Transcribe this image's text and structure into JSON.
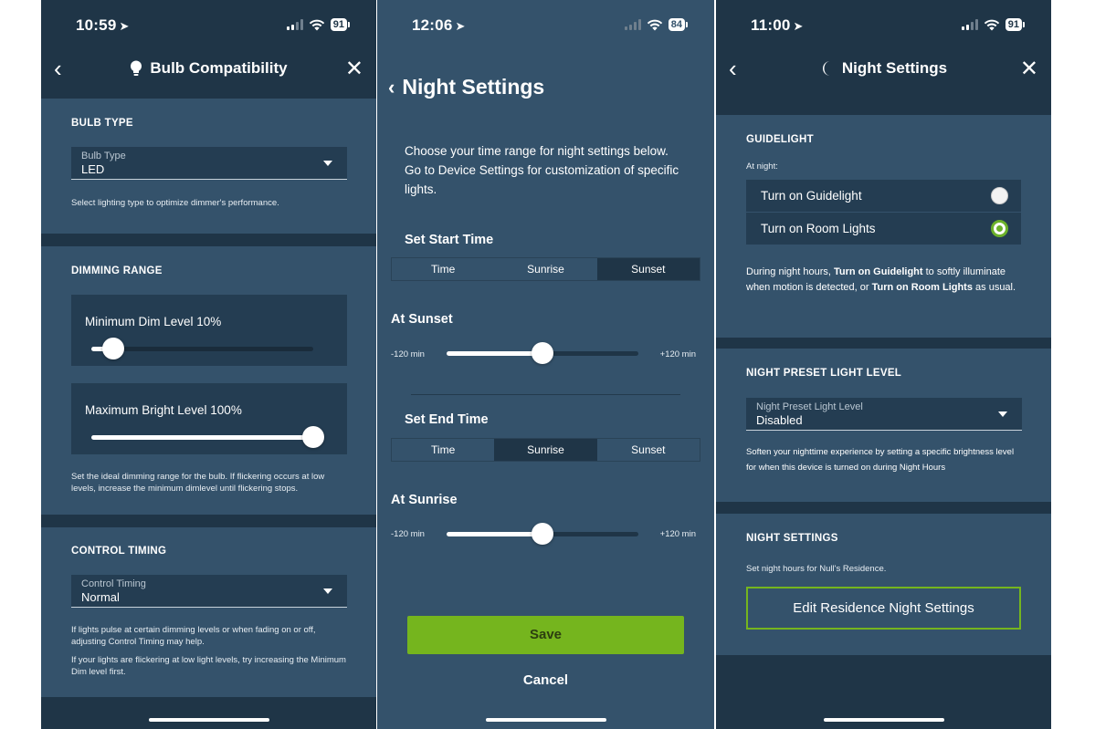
{
  "screen1": {
    "status": {
      "time": "10:59",
      "battery": "91"
    },
    "nav": {
      "title": "Bulb Compatibility"
    },
    "bulb_type": {
      "heading": "BULB TYPE",
      "dropdown_label": "Bulb Type",
      "dropdown_value": "LED",
      "help": "Select lighting type to optimize dimmer's performance."
    },
    "dimming_range": {
      "heading": "DIMMING RANGE",
      "min_label": "Minimum Dim Level 10%",
      "min_value_pct": 10,
      "max_label": "Maximum Bright Level 100%",
      "max_value_pct": 100,
      "help": "Set the ideal dimming range for the bulb. If flickering occurs at low levels, increase the minimum dimlevel until flickering stops."
    },
    "control_timing": {
      "heading": "CONTROL TIMING",
      "dropdown_label": "Control Timing",
      "dropdown_value": "Normal",
      "help1": "If lights pulse at certain dimming levels or when fading on or off, adjusting Control Timing may help.",
      "help2": "If your lights are flickering at low light levels, try increasing the Minimum Dim level first."
    }
  },
  "screen2": {
    "status": {
      "time": "12:06",
      "battery": "84"
    },
    "title": "Night Settings",
    "intro": "Choose your time range for night settings below. Go to Device Settings for customization of specific lights.",
    "start": {
      "heading": "Set Start Time",
      "options": [
        "Time",
        "Sunrise",
        "Sunset"
      ],
      "selected": "Sunset",
      "sub_heading": "At Sunset",
      "min_label": "-120 min",
      "max_label": "+120 min",
      "offset_min": 0
    },
    "end": {
      "heading": "Set End Time",
      "options": [
        "Time",
        "Sunrise",
        "Sunset"
      ],
      "selected": "Sunrise",
      "sub_heading": "At Sunrise",
      "min_label": "-120 min",
      "max_label": "+120 min",
      "offset_min": 0
    },
    "save_label": "Save",
    "cancel_label": "Cancel"
  },
  "screen3": {
    "status": {
      "time": "11:00",
      "battery": "91"
    },
    "nav": {
      "title": "Night Settings"
    },
    "guidelight": {
      "heading": "GUIDELIGHT",
      "sub": "At night:",
      "options": [
        "Turn on Guidelight",
        "Turn on Room Lights"
      ],
      "selected": "Turn on Room Lights",
      "desc_pre": "During night hours, ",
      "desc_b1": "Turn on Guidelight",
      "desc_mid": " to softly illuminate when motion is detected, or ",
      "desc_b2": "Turn on Room Lights",
      "desc_post": " as usual."
    },
    "preset": {
      "heading": "NIGHT PRESET LIGHT LEVEL",
      "dropdown_label": "Night Preset Light Level",
      "dropdown_value": "Disabled",
      "help": "Soften your nighttime experience by setting a specific brightness level for when this device is turned on during Night Hours"
    },
    "night_settings": {
      "heading": "NIGHT SETTINGS",
      "help": "Set night hours for Null's Residence.",
      "button_label": "Edit Residence Night Settings"
    }
  },
  "colors": {
    "header_dark": "#1f3547",
    "panel": "#34526b",
    "card": "#243d52",
    "accent_green": "#75b51e"
  }
}
